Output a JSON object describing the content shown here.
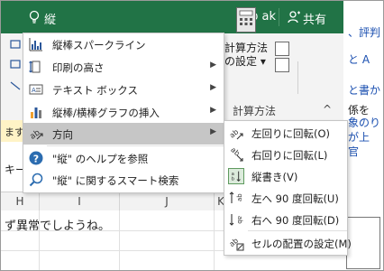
{
  "titlebar": {
    "search_text": "縦",
    "user_name": "Yip ak",
    "share_label": "共有"
  },
  "ribbon": {
    "calc_label_line1": "計算方法",
    "calc_label_line2": "の設定",
    "calc_group_caption": "計算方法",
    "collapse_glyph": "^"
  },
  "menu": {
    "items": [
      {
        "label": "縦棒スパークライン",
        "icon": "sparkline-column-icon",
        "has_submenu": false
      },
      {
        "label": "印刷の高さ",
        "icon": "print-height-icon",
        "has_submenu": true
      },
      {
        "label": "テキスト ボックス",
        "icon": "text-box-icon",
        "has_submenu": true
      },
      {
        "label": "縦棒/横棒グラフの挿入",
        "icon": "bar-chart-icon",
        "has_submenu": true
      },
      {
        "label": "方向",
        "icon": "orientation-icon",
        "has_submenu": true,
        "highlighted": true
      },
      {
        "label": "\"縦\" のヘルプを参照",
        "icon": "help-icon",
        "has_submenu": false
      },
      {
        "label": "\"縦\" に関するスマート検索",
        "icon": "smart-lookup-icon",
        "has_submenu": false
      }
    ]
  },
  "submenu": {
    "items": [
      {
        "label": "左回りに回転(O)",
        "icon": "rotate-counterclockwise-icon"
      },
      {
        "label": "右回りに回転(L)",
        "icon": "rotate-clockwise-icon"
      },
      {
        "label": "縦書き(V)",
        "icon": "vertical-text-icon",
        "checked": true
      },
      {
        "label": "左へ 90 度回転(U)",
        "icon": "rotate-up-icon"
      },
      {
        "label": "右へ 90 度回転(D)",
        "icon": "rotate-down-icon"
      },
      {
        "label": "セルの配置の設定(M)",
        "icon": "format-cell-alignment-icon"
      }
    ]
  },
  "sheet": {
    "message_bar_text": "ます。",
    "formula_text": "キー",
    "column_headers": [
      "H",
      "I",
      "J",
      "K"
    ],
    "cell_text": "ず異常でしようね。"
  },
  "web_strip": {
    "lines": [
      "、評判",
      "と A",
      "と書か",
      "係を",
      "象のり",
      "が上",
      "官"
    ]
  }
}
